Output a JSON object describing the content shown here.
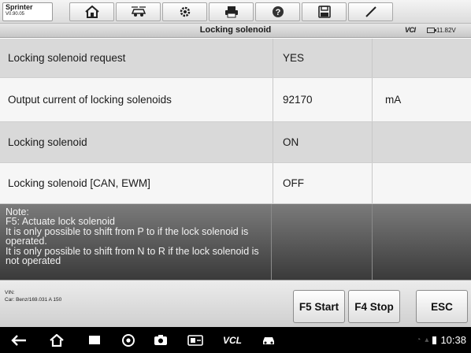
{
  "app": {
    "name": "Sprinter",
    "version": "V0.90.05"
  },
  "toolbar": {
    "buttons": [
      {
        "name": "home-icon"
      },
      {
        "name": "vehicle-swap-icon"
      },
      {
        "name": "settings-icon"
      },
      {
        "name": "print-icon"
      },
      {
        "name": "help-icon"
      },
      {
        "name": "save-icon"
      },
      {
        "name": "edit-icon"
      }
    ]
  },
  "titlebar": {
    "title": "Locking solenoid",
    "vci": "VCI",
    "voltage": "11.82V"
  },
  "rows": [
    {
      "name": "Locking solenoid request",
      "value": "YES",
      "unit": ""
    },
    {
      "name": "Output current of locking solenoids",
      "value": "92170",
      "unit": "mA"
    },
    {
      "name": "Locking solenoid",
      "value": "ON",
      "unit": ""
    },
    {
      "name": "Locking solenoid [CAN, EWM]",
      "value": "OFF",
      "unit": ""
    }
  ],
  "note": {
    "text": "Note:\nF5: Actuate lock solenoid\nIt is only possible to shift from P to if the lock solenoid is operated.\nIt is only possible to shift from N to R if the lock solenoid is not operated"
  },
  "footer": {
    "vin_label": "VIN:",
    "car_label": "Car: Benz/169.031 A 150",
    "buttons": {
      "f5": "F5 Start",
      "f4": "F4 Stop",
      "esc": "ESC"
    }
  },
  "navbar": {
    "vcl": "VCL",
    "clock": "10:38"
  }
}
